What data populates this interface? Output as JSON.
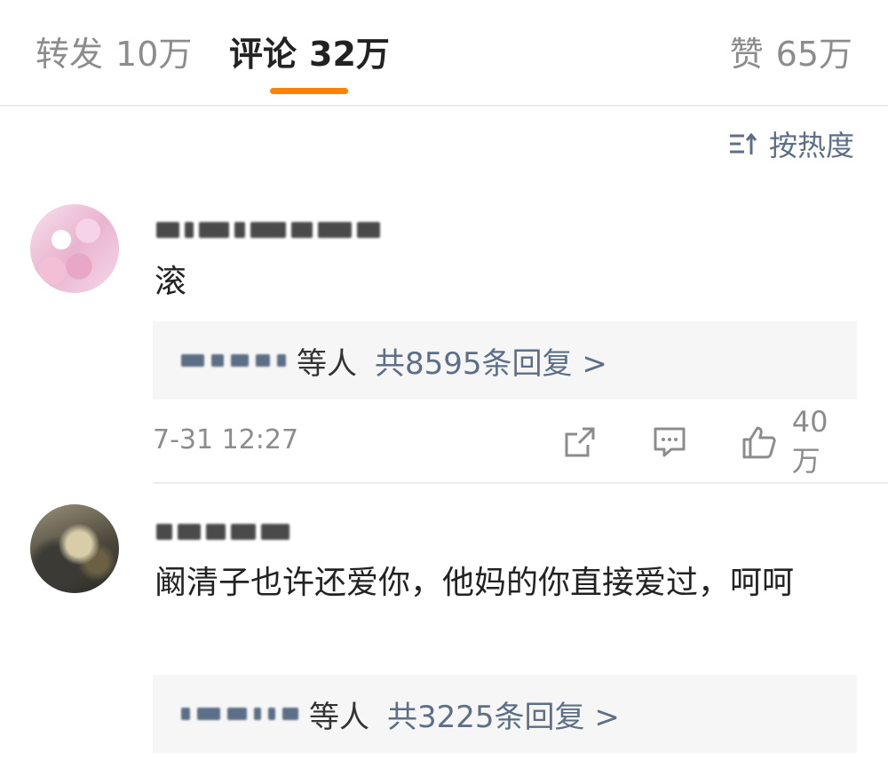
{
  "tabs": {
    "repost": {
      "label": "转发",
      "count": "10万"
    },
    "comments": {
      "label": "评论",
      "count": "32万"
    },
    "likes": {
      "label": "赞",
      "count": "65万"
    },
    "accent_color": "#ff8200"
  },
  "sort": {
    "label": "按热度",
    "icon": "sort-icon"
  },
  "comments": [
    {
      "text": "滚",
      "reply_suffix": "等人",
      "reply_count": "共8595条回复 >",
      "time": "7-31 12:27",
      "likes": "40万"
    },
    {
      "text": "阚清子也许还爱你，他妈的你直接爱过，呵呵",
      "reply_suffix": "等人",
      "reply_count": "共3225条回复 >"
    }
  ],
  "colors": {
    "link": "#5d6f86",
    "muted": "#8c8c8c",
    "text": "#222222"
  }
}
